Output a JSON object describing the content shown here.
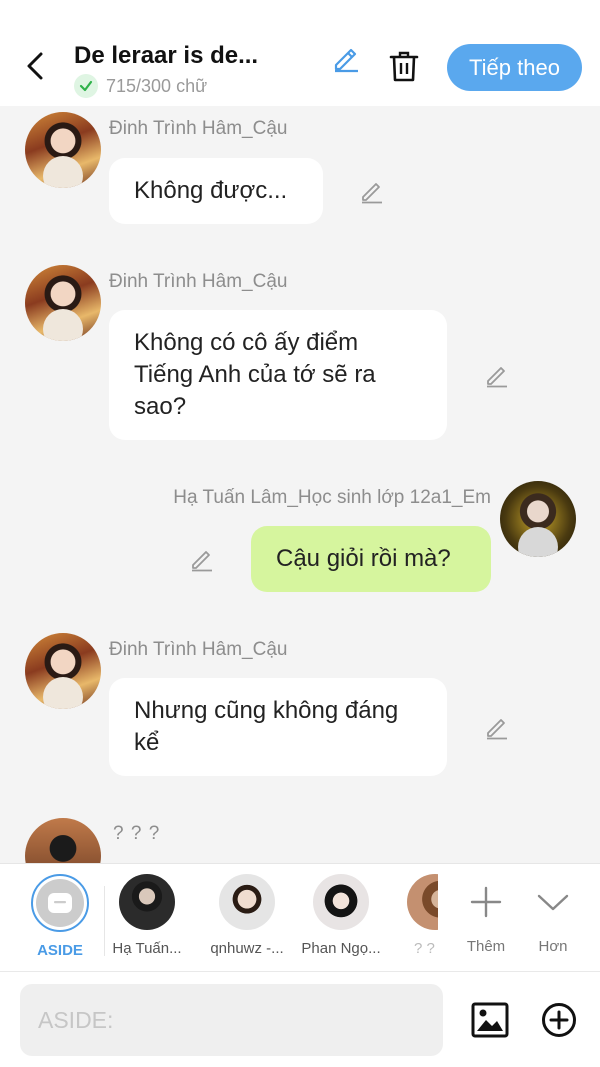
{
  "header": {
    "title": "De leraar is de...",
    "word_count": "715/300 chữ",
    "next_label": "Tiếp theo",
    "accent": "#5aa8ee"
  },
  "messages": [
    {
      "sender": "Đinh Trình Hâm_Cậu",
      "text": "Không được...",
      "side": "left"
    },
    {
      "sender": "Đinh Trình Hâm_Cậu",
      "text": "Không có cô ấy điểm Tiếng Anh của tớ sẽ ra sao?",
      "side": "left"
    },
    {
      "sender": "Hạ Tuấn Lâm_Học sinh lớp 12a1_Em",
      "text": "Cậu giỏi rồi mà?",
      "side": "right"
    },
    {
      "sender": "Đinh Trình Hâm_Cậu",
      "text": "Nhưng cũng không đáng kể",
      "side": "left"
    },
    {
      "sender": "? ? ?",
      "text": "",
      "side": "left"
    }
  ],
  "characters": [
    {
      "label": "ASIDE",
      "active": true
    },
    {
      "label": "Hạ Tuấn..."
    },
    {
      "label": "qnhuwz -..."
    },
    {
      "label": "Phan Ngọ..."
    },
    {
      "label": "? ?"
    }
  ],
  "actions": {
    "add_label": "Thêm",
    "more_label": "Hơn"
  },
  "input": {
    "placeholder": "ASIDE:"
  },
  "colors": {
    "mine_bubble": "#d6f59e",
    "other_bubble": "#ffffff",
    "background": "#f4f4f4"
  }
}
